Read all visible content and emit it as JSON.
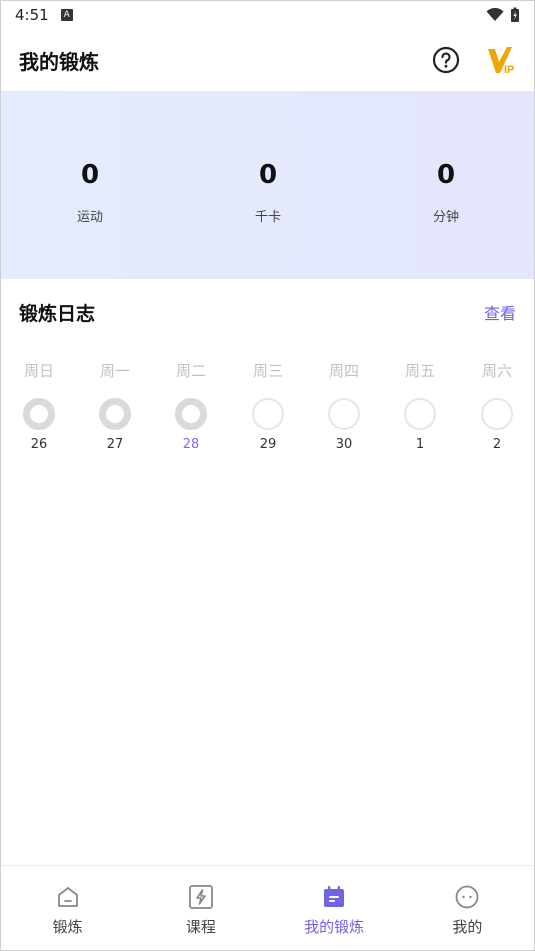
{
  "status_bar": {
    "time": "4:51",
    "badge": "A"
  },
  "header": {
    "title": "我的锻炼"
  },
  "stats": [
    {
      "value": "0",
      "label": "运动"
    },
    {
      "value": "0",
      "label": "千卡"
    },
    {
      "value": "0",
      "label": "分钟"
    }
  ],
  "log": {
    "title": "锻炼日志",
    "view_label": "查看",
    "days": [
      {
        "weekday": "周日",
        "date": "26",
        "done": true,
        "today": false
      },
      {
        "weekday": "周一",
        "date": "27",
        "done": true,
        "today": false
      },
      {
        "weekday": "周二",
        "date": "28",
        "done": true,
        "today": true
      },
      {
        "weekday": "周三",
        "date": "29",
        "done": false,
        "today": false
      },
      {
        "weekday": "周四",
        "date": "30",
        "done": false,
        "today": false
      },
      {
        "weekday": "周五",
        "date": "1",
        "done": false,
        "today": false
      },
      {
        "weekday": "周六",
        "date": "2",
        "done": false,
        "today": false
      }
    ]
  },
  "nav": {
    "items": [
      {
        "label": "锻炼",
        "icon": "home-icon",
        "active": false
      },
      {
        "label": "课程",
        "icon": "lightning-icon",
        "active": false
      },
      {
        "label": "我的锻炼",
        "icon": "calendar-icon",
        "active": true
      },
      {
        "label": "我的",
        "icon": "profile-icon",
        "active": false
      }
    ]
  },
  "colors": {
    "accent": "#7063e6",
    "vip": "#f0a500",
    "banner_start": "#e4ecfd",
    "banner_end": "#e4e6fb"
  }
}
